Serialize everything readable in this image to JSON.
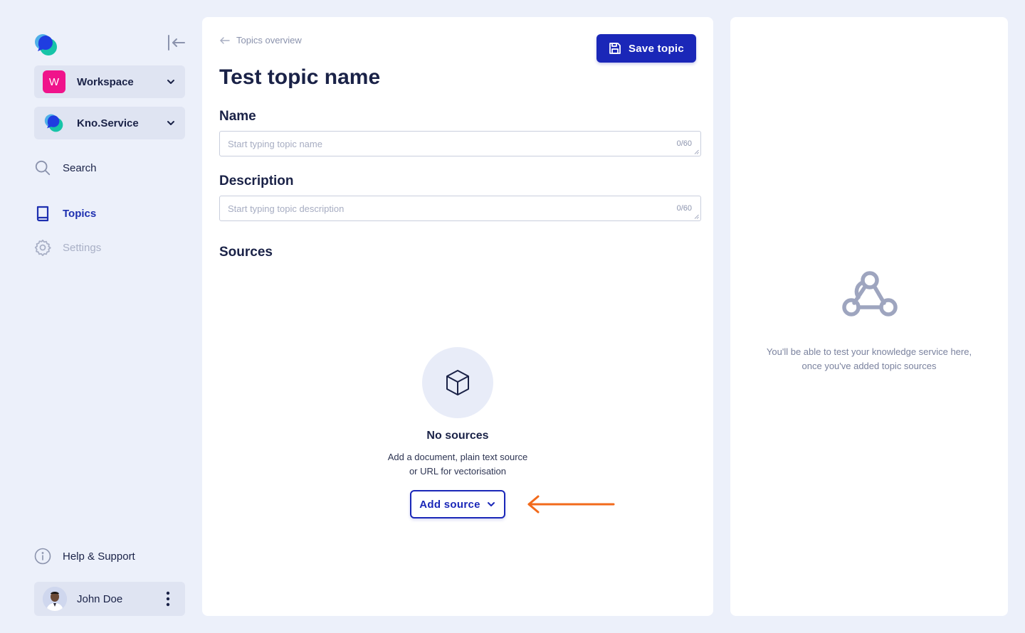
{
  "sidebar": {
    "workspace": {
      "badge": "W",
      "label": "Workspace"
    },
    "service": {
      "label": "Kno.Service"
    },
    "nav": {
      "search": "Search",
      "topics": "Topics",
      "settings": "Settings",
      "help": "Help & Support"
    },
    "user": {
      "name": "John Doe"
    }
  },
  "main": {
    "breadcrumb": "Topics overview",
    "save_label": "Save topic",
    "title": "Test topic name",
    "name_label": "Name",
    "name_placeholder": "Start typing topic name",
    "name_counter": "0/60",
    "description_label": "Description",
    "description_placeholder": "Start typing topic description",
    "description_counter": "0/60",
    "sources_label": "Sources",
    "empty": {
      "title": "No sources",
      "line1": "Add a document, plain text source",
      "line2": "or URL for vectorisation",
      "button_label": "Add source"
    }
  },
  "right_panel": {
    "line1": "You'll be able to test your knowledge service here,",
    "line2": "once you've added topic sources"
  },
  "colors": {
    "accent": "#1a27b8",
    "workspace_badge": "#f0138b",
    "annotation_arrow": "#f26a1b",
    "background": "#ecf0fa"
  },
  "icons": {
    "logo": "chat-bubble-logo-icon",
    "collapse": "collapse-sidebar-icon",
    "search": "search-icon",
    "topics": "book-icon",
    "settings": "gear-icon",
    "help": "info-icon",
    "more": "kebab-menu-icon",
    "save": "floppy-disk-icon",
    "empty": "cube-icon",
    "right_panel": "webhook-icon"
  }
}
